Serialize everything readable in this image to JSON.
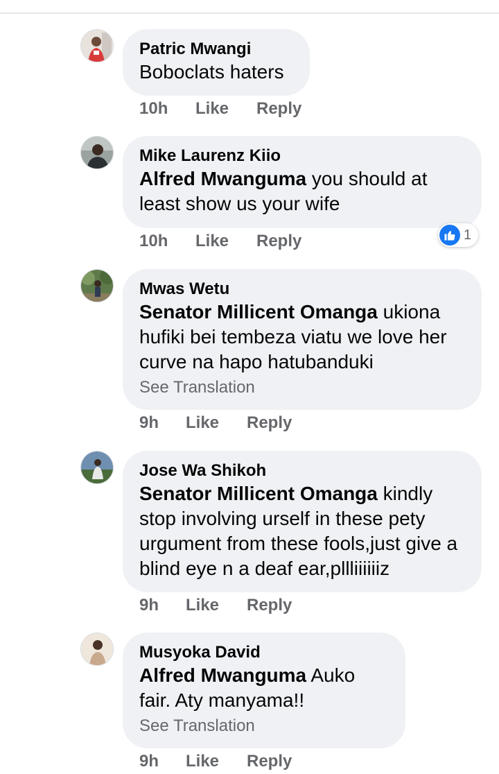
{
  "comments": [
    {
      "author": "Patric Mwangi",
      "mention": "",
      "text": "Boboclats haters",
      "see_translation": "",
      "time": "10h",
      "like": "Like",
      "reply": "Reply",
      "reaction_count": ""
    },
    {
      "author": "Mike Laurenz Kiio",
      "mention": "Alfred Mwanguma",
      "text": "you should at least show us your wife",
      "see_translation": "",
      "time": "10h",
      "like": "Like",
      "reply": "Reply",
      "reaction_count": "1"
    },
    {
      "author": "Mwas Wetu",
      "mention": "Senator Millicent Omanga",
      "text": "ukiona hufiki bei tembeza viatu we love her curve na hapo hatubanduki",
      "see_translation": "See Translation",
      "time": "9h",
      "like": "Like",
      "reply": "Reply",
      "reaction_count": ""
    },
    {
      "author": "Jose Wa Shikoh",
      "mention": "Senator Millicent Omanga",
      "text": "kindly stop involving urself in these pety urgument from these fools,just give a blind eye n a deaf ear,pllliiiiiiz",
      "see_translation": "",
      "time": "9h",
      "like": "Like",
      "reply": "Reply",
      "reaction_count": ""
    },
    {
      "author": "Musyoka David",
      "mention": "Alfred Mwanguma",
      "text": "Auko fair. Aty manyama!!",
      "see_translation": "See Translation",
      "time": "9h",
      "like": "Like",
      "reply": "Reply",
      "reaction_count": ""
    }
  ],
  "colors": {
    "bubble": "#eff1f4",
    "meta_text": "#65676b",
    "like_blue": "#1877f2"
  }
}
